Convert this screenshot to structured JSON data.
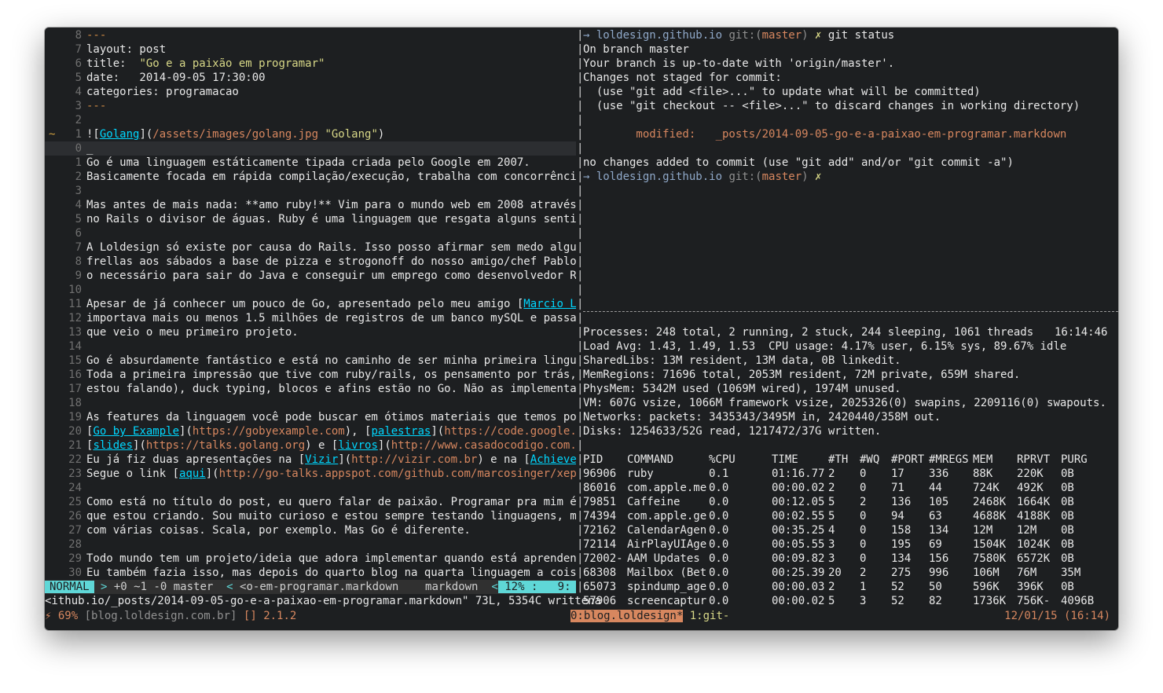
{
  "vim": {
    "lines": [
      {
        "n": "8",
        "segs": [
          [
            "---",
            "mark"
          ]
        ]
      },
      {
        "n": "7",
        "segs": [
          [
            "layout: post",
            ""
          ]
        ]
      },
      {
        "n": "6",
        "segs": [
          [
            "title:  ",
            ""
          ],
          [
            "\"Go e a paixão em programar\"",
            "str"
          ]
        ]
      },
      {
        "n": "5",
        "segs": [
          [
            "date:   2014-09-05 17:30:00",
            ""
          ]
        ]
      },
      {
        "n": "4",
        "segs": [
          [
            "categories: programacao",
            ""
          ]
        ]
      },
      {
        "n": "3",
        "segs": [
          [
            "---",
            "mark"
          ]
        ]
      },
      {
        "n": "2",
        "segs": []
      },
      {
        "n": "1",
        "sign": "~",
        "segs": [
          [
            "![",
            ""
          ],
          [
            "Golang",
            "link"
          ],
          [
            "](",
            ""
          ],
          [
            "/assets/images/golang.jpg",
            "orange"
          ],
          [
            " \"Golang\"",
            "str"
          ],
          [
            ")",
            ""
          ]
        ]
      },
      {
        "n": "0",
        "cur": true,
        "segs": [
          [
            "_",
            ""
          ]
        ]
      },
      {
        "n": "1",
        "segs": [
          [
            "Go é uma linguagem estáticamente tipada criada pelo Google em 2007.",
            ""
          ]
        ]
      },
      {
        "n": "2",
        "segs": [
          [
            "Basicamente focada em rápida compilação/execução, trabalha com concorrência e",
            ""
          ]
        ]
      },
      {
        "n": "3",
        "segs": []
      },
      {
        "n": "4",
        "segs": [
          [
            "Mas antes de mais nada: **amo ruby!** Vim para o mundo web em 2008 através de",
            ""
          ]
        ]
      },
      {
        "n": "5",
        "segs": [
          [
            "no Rails o divisor de águas. Ruby é uma linguagem que resgata alguns sentiment",
            ""
          ]
        ]
      },
      {
        "n": "6",
        "segs": []
      },
      {
        "n": "7",
        "segs": [
          [
            "A Loldesign só existe por causa do Rails. Isso posso afirmar sem medo algum. M",
            ""
          ]
        ]
      },
      {
        "n": "8",
        "segs": [
          [
            "frellas aos sábados a base de pizza e strogonoff do nosso amigo/chef Pablo, no",
            ""
          ]
        ]
      },
      {
        "n": "9",
        "segs": [
          [
            "o necessário para sair do Java e conseguir um emprego como desenvolvedor Rails",
            ""
          ]
        ]
      },
      {
        "n": "10",
        "segs": []
      },
      {
        "n": "11",
        "segs": [
          [
            "Apesar de já conhecer um pouco de Go, apresentado pelo meu amigo [",
            ""
          ],
          [
            "Marcio Lopes",
            "link"
          ]
        ]
      },
      {
        "n": "12",
        "segs": [
          [
            "importava mais ou menos 1.5 milhões de registros de um banco mySQL e passava p",
            ""
          ]
        ]
      },
      {
        "n": "13",
        "segs": [
          [
            "que veio o meu primeiro projeto.",
            ""
          ]
        ]
      },
      {
        "n": "14",
        "segs": []
      },
      {
        "n": "15",
        "segs": [
          [
            "Go é absurdamente fantástico e está no caminho de ser minha primeira linguagem",
            ""
          ]
        ]
      },
      {
        "n": "16",
        "segs": [
          [
            "Toda a primeira impressão que tive com ruby/rails, os pensamento por trás, fac",
            ""
          ]
        ]
      },
      {
        "n": "17",
        "segs": [
          [
            "estou falando), duck typing, blocos e afins estão no Go. Não as implementações",
            ""
          ]
        ]
      },
      {
        "n": "18",
        "segs": []
      },
      {
        "n": "19",
        "segs": [
          [
            "As features da linguagem você pode buscar em ótimos materiais que temos por ai",
            ""
          ]
        ]
      },
      {
        "n": "20",
        "segs": [
          [
            "[",
            ""
          ],
          [
            "Go by Example",
            "link"
          ],
          [
            "](",
            ""
          ],
          [
            "https://gobyexample.com",
            "orange"
          ],
          [
            "), [",
            ""
          ],
          [
            "palestras",
            "link"
          ],
          [
            "](",
            ""
          ],
          [
            "https://code.google.com/",
            "orange"
          ]
        ]
      },
      {
        "n": "21",
        "segs": [
          [
            "[",
            ""
          ],
          [
            "slides",
            "link"
          ],
          [
            "](",
            ""
          ],
          [
            "https://talks.golang.org",
            "orange"
          ],
          [
            ") e [",
            ""
          ],
          [
            "livros",
            "link"
          ],
          [
            "](",
            ""
          ],
          [
            "http://www.casadocodigo.com.br/p",
            "orange"
          ]
        ]
      },
      {
        "n": "22",
        "segs": [
          [
            "Eu já fiz duas apresentações na [",
            ""
          ],
          [
            "Vizir",
            "link"
          ],
          [
            "](",
            ""
          ],
          [
            "http://vizir.com.br",
            "orange"
          ],
          [
            ") e na [",
            ""
          ],
          [
            "AchieveMore",
            "link"
          ]
        ]
      },
      {
        "n": "23",
        "segs": [
          [
            "Segue o link [",
            ""
          ],
          [
            "aqui",
            "link"
          ],
          [
            "](",
            ""
          ],
          [
            "http://go-talks.appspot.com/github.com/marcosinger/xepa-go",
            "orange"
          ]
        ]
      },
      {
        "n": "24",
        "segs": []
      },
      {
        "n": "25",
        "segs": [
          [
            "Como está no título do post, eu quero falar de paixão. Programar pra mim é uma",
            ""
          ]
        ]
      },
      {
        "n": "26",
        "segs": [
          [
            "que estou criando. Sou muito curioso e estou sempre testando linguagens, metod",
            ""
          ]
        ]
      },
      {
        "n": "27",
        "segs": [
          [
            "com várias coisas. Scala, por exemplo. Mas Go é diferente.",
            ""
          ]
        ]
      },
      {
        "n": "28",
        "segs": []
      },
      {
        "n": "29",
        "segs": [
          [
            "Todo mundo tem um projeto/ideia que adora implementar quando está aprendendo a",
            ""
          ]
        ]
      },
      {
        "n": "30",
        "segs": [
          [
            "Eu também fazia isso, mas depois do quarto blog na quarta linguagem a coisa fi",
            ""
          ]
        ]
      }
    ],
    "statusline": {
      "mode": "NORMAL",
      "git": "+0 ~1 -0 master",
      "file": "<o-em-programar.markdown",
      "filetype": "markdown",
      "percent": "12%",
      "position": "9:  0"
    },
    "cmdline": "<ithub.io/_posts/2014-09-05-go-e-a-paixao-em-programar.markdown\" 73L, 5354C writtena"
  },
  "git": {
    "lines": [
      [
        [
          "→ ",
          "blue"
        ],
        [
          "loldesign.github.io ",
          "blue"
        ],
        [
          "git:(",
          "dim"
        ],
        [
          "master",
          "orange"
        ],
        [
          ") ",
          "dim"
        ],
        [
          "✗ ",
          "str"
        ],
        [
          "git status",
          ""
        ]
      ],
      [
        [
          "On branch master",
          ""
        ]
      ],
      [
        [
          "Your branch is up-to-date with 'origin/master'.",
          ""
        ]
      ],
      [
        [
          "Changes not staged for commit:",
          ""
        ]
      ],
      [
        [
          "  (use \"git add <file>...\" to update what will be committed)",
          ""
        ]
      ],
      [
        [
          "  (use \"git checkout -- <file>...\" to discard changes in working directory)",
          ""
        ]
      ],
      [],
      [
        [
          "        modified:   _posts/2014-09-05-go-e-a-paixao-em-programar.markdown",
          "orange"
        ]
      ],
      [],
      [
        [
          "no changes added to commit (use \"git add\" and/or \"git commit -a\")",
          ""
        ]
      ],
      [
        [
          "→ ",
          "blue"
        ],
        [
          "loldesign.github.io ",
          "blue"
        ],
        [
          "git:(",
          "dim"
        ],
        [
          "master",
          "orange"
        ],
        [
          ") ",
          "dim"
        ],
        [
          "✗",
          "str"
        ]
      ]
    ]
  },
  "top": {
    "summary": [
      "Processes: 248 total, 2 running, 2 stuck, 244 sleeping, 1061 threads",
      "Load Avg: 1.43, 1.49, 1.53  CPU usage: 4.17% user, 6.15% sys, 89.67% idle",
      "SharedLibs: 13M resident, 13M data, 0B linkedit.",
      "MemRegions: 71696 total, 2053M resident, 72M private, 659M shared.",
      "PhysMem: 5342M used (1069M wired), 1974M unused.",
      "VM: 607G vsize, 1066M framework vsize, 2025326(0) swapins, 2209116(0) swapouts.",
      "Networks: packets: 3435343/3495M in, 2420440/358M out.",
      "Disks: 1254633/52G read, 1217472/37G written."
    ],
    "clock": "16:14:46",
    "columns": [
      "PID",
      "COMMAND",
      "%CPU",
      "TIME",
      "#TH",
      "#WQ",
      "#PORT",
      "#MREGS",
      "MEM",
      "RPRVT",
      "PURG"
    ],
    "rows": [
      [
        "96906",
        "ruby",
        "0.1",
        "01:16.77",
        "2",
        "0",
        "17",
        "336",
        "88K",
        "220K",
        "0B"
      ],
      [
        "86016",
        "com.apple.me",
        "0.0",
        "00:00.02",
        "2",
        "0",
        "71",
        "44",
        "724K",
        "492K",
        "0B"
      ],
      [
        "79851",
        "Caffeine",
        "0.0",
        "00:12.05",
        "5",
        "2",
        "136",
        "105",
        "2468K",
        "1664K",
        "0B"
      ],
      [
        "74394",
        "com.apple.ge",
        "0.0",
        "00:02.55",
        "5",
        "0",
        "94",
        "63",
        "4688K",
        "4188K",
        "0B"
      ],
      [
        "72162",
        "CalendarAgen",
        "0.0",
        "00:35.25",
        "4",
        "0",
        "158",
        "134",
        "12M",
        "12M",
        "0B"
      ],
      [
        "72114",
        "AirPlayUIAge",
        "0.0",
        "00:05.55",
        "3",
        "0",
        "195",
        "69",
        "1504K",
        "1024K",
        "0B"
      ],
      [
        "72002-",
        "AAM Updates",
        "0.0",
        "00:09.82",
        "3",
        "0",
        "134",
        "156",
        "7580K",
        "6572K",
        "0B"
      ],
      [
        "68308",
        "Mailbox (Bet",
        "0.0",
        "00:25.39",
        "20",
        "2",
        "275",
        "996",
        "106M",
        "76M",
        "35M"
      ],
      [
        "65073",
        "spindump_age",
        "0.0",
        "00:00.03",
        "2",
        "1",
        "52",
        "50",
        "596K",
        "396K",
        "0B"
      ],
      [
        "57906",
        "screencaptur",
        "0.0",
        "00:00.02",
        "5",
        "3",
        "52",
        "82",
        "1736K",
        "756K-",
        "4096B"
      ]
    ]
  },
  "tmux": {
    "battery": "⚡ 69%",
    "host": "[blog.loldesign.com.br]",
    "ruby": "[] 2.1.2",
    "window_active": "0:blog.loldesign*",
    "window_other": " 1:git-",
    "datetime": "12/01/15 (16:14)"
  }
}
